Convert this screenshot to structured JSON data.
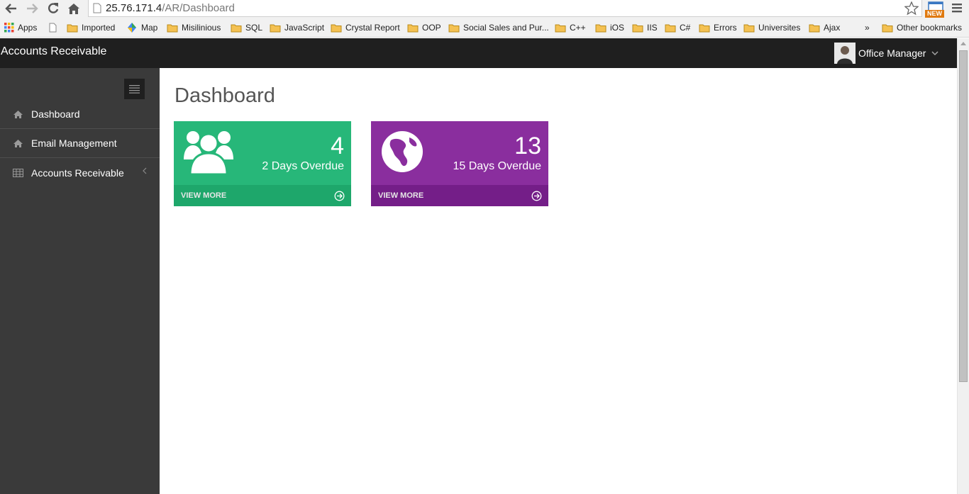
{
  "browser": {
    "url_host": "25.76.171.4",
    "url_path": "/AR/Dashboard",
    "ext_badge": "NEW",
    "bookmarks": [
      {
        "label": "Apps",
        "icon": "apps-grid-icon"
      },
      {
        "label": "",
        "icon": "page-icon"
      },
      {
        "label": "Imported",
        "icon": "folder-icon"
      },
      {
        "label": "Map",
        "icon": "maps-icon"
      },
      {
        "label": "Misilinious",
        "icon": "folder-icon"
      },
      {
        "label": "SQL",
        "icon": "folder-icon"
      },
      {
        "label": "JavaScript",
        "icon": "folder-icon"
      },
      {
        "label": "Crystal Report",
        "icon": "folder-icon"
      },
      {
        "label": "OOP",
        "icon": "folder-icon"
      },
      {
        "label": "Social Sales and Pur...",
        "icon": "folder-icon"
      },
      {
        "label": "C++",
        "icon": "folder-icon"
      },
      {
        "label": "iOS",
        "icon": "folder-icon"
      },
      {
        "label": "IIS",
        "icon": "folder-icon"
      },
      {
        "label": "C#",
        "icon": "folder-icon"
      },
      {
        "label": "Errors",
        "icon": "folder-icon"
      },
      {
        "label": "Universites",
        "icon": "folder-icon"
      },
      {
        "label": "Ajax",
        "icon": "folder-icon"
      }
    ],
    "overflow": "»",
    "other_bookmarks": "Other bookmarks"
  },
  "header": {
    "brand": "Accounts Receivable",
    "user_name": "Office Manager"
  },
  "sidebar": {
    "items": [
      {
        "label": "Dashboard",
        "icon": "home-icon"
      },
      {
        "label": "Email Management",
        "icon": "home-icon"
      },
      {
        "label": "Accounts Receivable",
        "icon": "table-icon"
      }
    ]
  },
  "main": {
    "title": "Dashboard",
    "tiles": [
      {
        "count": "4",
        "label": "2 Days Overdue",
        "more": "VIEW MORE",
        "color": "#27b779",
        "icon": "users-icon"
      },
      {
        "count": "13",
        "label": "15 Days Overdue",
        "more": "VIEW MORE",
        "color": "#8a2e9e",
        "icon": "globe-icon"
      }
    ]
  }
}
